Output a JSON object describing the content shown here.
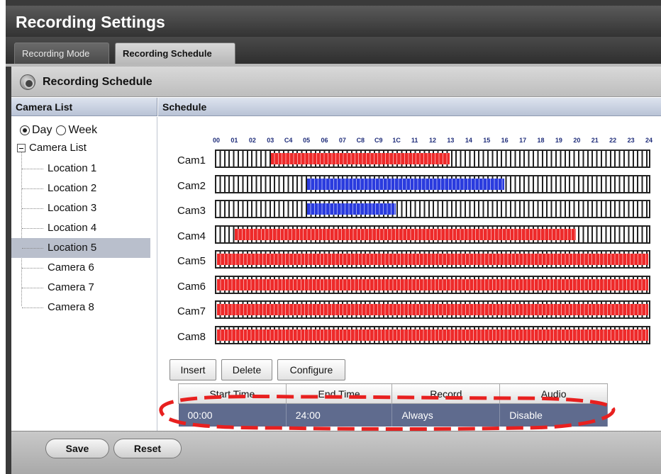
{
  "title": "Recording Settings",
  "tabs": [
    {
      "label": "Recording Mode",
      "active": false
    },
    {
      "label": "Recording Schedule",
      "active": true
    }
  ],
  "section": {
    "icon": "camera-icon",
    "title": "Recording Schedule"
  },
  "camera_list": {
    "header": "Camera List",
    "view_options": [
      {
        "label": "Day",
        "selected": true
      },
      {
        "label": "Week",
        "selected": false
      }
    ],
    "root": "Camera List",
    "items": [
      "Location 1",
      "Location 2",
      "Location 3",
      "Location 4",
      "Location 5",
      "Camera 6",
      "Camera 7",
      "Camera 8"
    ],
    "selected_index": 4
  },
  "schedule": {
    "header": "Schedule",
    "hours": [
      "00",
      "01",
      "02",
      "03",
      "C4",
      "05",
      "06",
      "07",
      "C8",
      "C9",
      "1C",
      "11",
      "12",
      "13",
      "14",
      "15",
      "16",
      "17",
      "18",
      "19",
      "20",
      "21",
      "22",
      "23",
      "24"
    ],
    "cameras": [
      {
        "label": "Cam1",
        "start": 3,
        "end": 13,
        "color": "#ee2a2a"
      },
      {
        "label": "Cam2",
        "start": 5,
        "end": 16,
        "color": "#2a3bde"
      },
      {
        "label": "Cam3",
        "start": 5,
        "end": 10,
        "color": "#2a3bde"
      },
      {
        "label": "Cam4",
        "start": 1,
        "end": 20,
        "color": "#ee2a2a"
      },
      {
        "label": "Cam5",
        "start": 0,
        "end": 24,
        "color": "#ee2a2a"
      },
      {
        "label": "Cam6",
        "start": 0,
        "end": 24,
        "color": "#ee2a2a"
      },
      {
        "label": "Cam7",
        "start": 0,
        "end": 24,
        "color": "#ee2a2a"
      },
      {
        "label": "Cam8",
        "start": 0,
        "end": 24,
        "color": "#ee2a2a"
      }
    ]
  },
  "actions": {
    "insert": "Insert",
    "delete": "Delete",
    "configure": "Configure"
  },
  "rules_table": {
    "columns": [
      "Start Time",
      "End Time",
      "Record",
      "Audio"
    ],
    "rows": [
      [
        "00:00",
        "24:00",
        "Always",
        "Disable"
      ]
    ]
  },
  "footer": {
    "save": "Save",
    "reset": "Reset"
  },
  "colors": {
    "record_red": "#ee2a2a",
    "record_blue": "#2a3bde",
    "annotation": "#e8201f"
  }
}
